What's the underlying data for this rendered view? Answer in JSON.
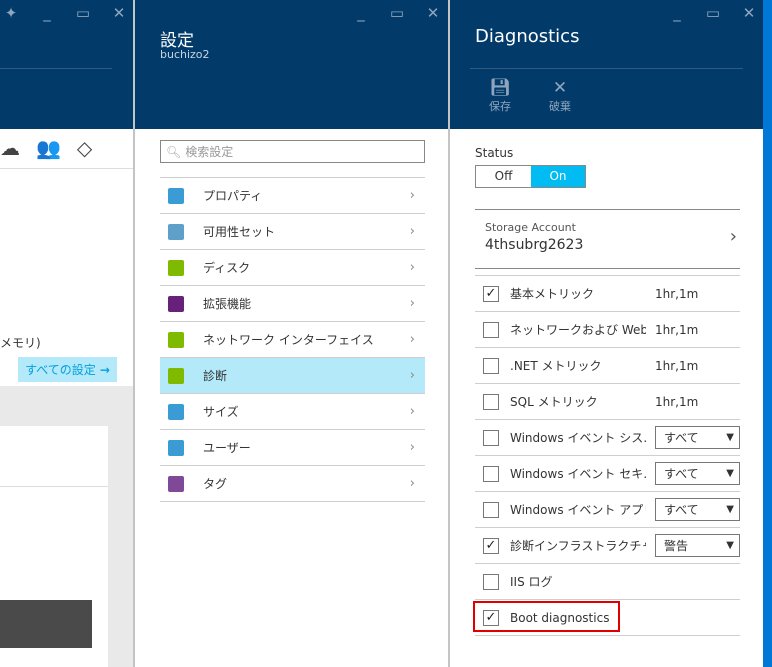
{
  "left_blade": {
    "partial_text": "メモリ)",
    "all_settings_label": "すべての設定",
    "all_settings_arrow": "→"
  },
  "settings_blade": {
    "title": "設定",
    "subtitle": "buchizo2",
    "search_placeholder": "検索設定",
    "items": [
      {
        "label": "プロパティ",
        "icon": "properties-icon",
        "color": "#3a9bd5"
      },
      {
        "label": "可用性セット",
        "icon": "availability-set-icon",
        "color": "#5ea0c9"
      },
      {
        "label": "ディスク",
        "icon": "disk-icon",
        "color": "#7fba00"
      },
      {
        "label": "拡張機能",
        "icon": "extensions-icon",
        "color": "#68217a"
      },
      {
        "label": "ネットワーク インターフェイス",
        "icon": "network-interface-icon",
        "color": "#7fba00"
      },
      {
        "label": "診断",
        "icon": "diagnostics-icon",
        "color": "#7fba00",
        "selected": true
      },
      {
        "label": "サイズ",
        "icon": "size-icon",
        "color": "#3a9bd5"
      },
      {
        "label": "ユーザー",
        "icon": "users-icon",
        "color": "#3a9bd5"
      },
      {
        "label": "タグ",
        "icon": "tag-icon",
        "color": "#804998"
      }
    ]
  },
  "diagnostics_blade": {
    "title": "Diagnostics",
    "save_label": "保存",
    "discard_label": "破棄",
    "status_label": "Status",
    "status_off": "Off",
    "status_on": "On",
    "status_value": "On",
    "storage_label": "Storage Account",
    "storage_value": "4thsubrg2623",
    "rows": [
      {
        "label": "基本メトリック",
        "checked": true,
        "value": "1hr,1m"
      },
      {
        "label": "ネットワークおよび Web …",
        "checked": false,
        "value": "1hr,1m"
      },
      {
        "label": ".NET メトリック",
        "checked": false,
        "value": "1hr,1m"
      },
      {
        "label": "SQL メトリック",
        "checked": false,
        "value": "1hr,1m"
      },
      {
        "label": "Windows イベント シス…",
        "checked": false,
        "select": "すべて"
      },
      {
        "label": "Windows イベント セキ…",
        "checked": false,
        "select": "すべて"
      },
      {
        "label": "Windows イベント アプリ…",
        "checked": false,
        "select": "すべて"
      },
      {
        "label": "診断インフラストラクチャ ログ",
        "checked": true,
        "select": "警告"
      },
      {
        "label": "IIS ログ",
        "checked": false
      },
      {
        "label": "Boot diagnostics",
        "checked": true,
        "highlighted": true
      }
    ]
  },
  "colors": {
    "header": "#023b69",
    "accent": "#00bcf2",
    "selected": "#b3e9f8",
    "highlight": "#e00000",
    "scrollbar": "#0078d7"
  }
}
